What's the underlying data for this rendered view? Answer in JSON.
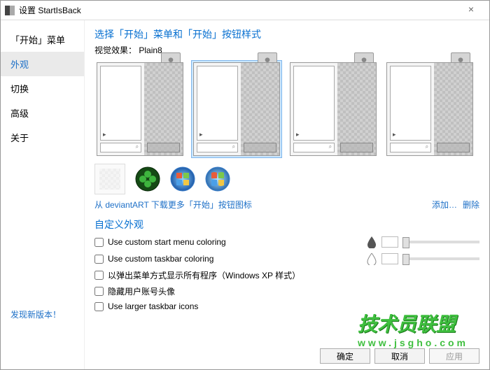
{
  "titlebar": {
    "title": "设置 StartIsBack"
  },
  "sidebar": {
    "items": [
      {
        "label": "「开始」菜单"
      },
      {
        "label": "外观"
      },
      {
        "label": "切换"
      },
      {
        "label": "高级"
      },
      {
        "label": "关于"
      }
    ],
    "active_index": 1,
    "new_version": "发现新版本！"
  },
  "section": {
    "title": "选择「开始」菜单和「开始」按钮样式",
    "effect_label": "视觉效果：",
    "effect_value": "Plain8"
  },
  "links": {
    "download": "从 deviantART 下载更多「开始」按钮图标",
    "add": "添加…",
    "delete": "删除"
  },
  "custom": {
    "title": "自定义外观",
    "options": [
      "Use custom start menu coloring",
      "Use custom taskbar coloring",
      "以弹出菜单方式显示所有程序（Windows XP 样式）",
      "隐藏用户账号头像",
      "Use larger taskbar icons"
    ]
  },
  "buttons": {
    "ok": "确定",
    "cancel": "取消",
    "apply": "应用"
  },
  "watermark": {
    "main": "技术员联盟",
    "sub": "www.jsgho.com"
  }
}
